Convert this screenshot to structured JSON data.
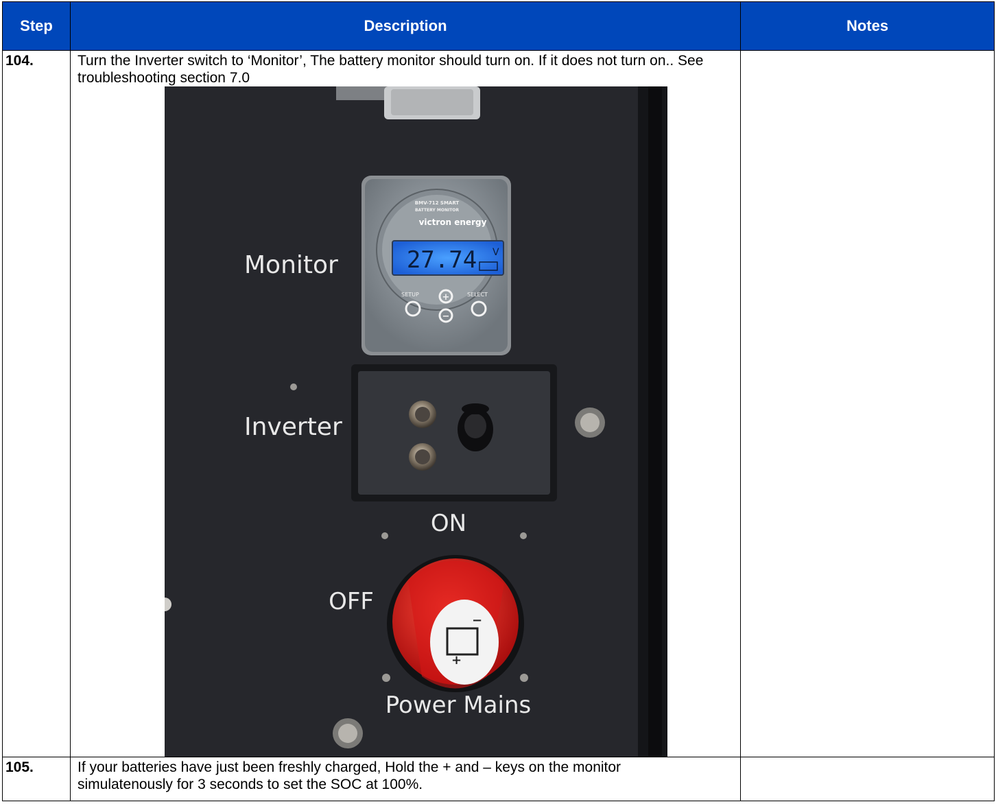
{
  "headers": {
    "step": "Step",
    "description": "Description",
    "notes": "Notes"
  },
  "rows": [
    {
      "step": "104.",
      "description": "Turn the Inverter switch to ‘Monitor’, The battery monitor should turn on. If it does not turn on.. See troubleshooting section 7.0",
      "notes": ""
    },
    {
      "step": "105.",
      "description": "If your batteries have just been freshly charged, Hold the + and – keys on the monitor simulatenously for 3 seconds to set the SOC at 100%.",
      "notes": ""
    }
  ],
  "photo": {
    "label_monitor": "Monitor",
    "label_inverter": "Inverter",
    "label_on": "ON",
    "label_off": "OFF",
    "label_power_mains": "Power Mains",
    "monitor_model": "BMV-712 SMART",
    "monitor_subtitle": "BATTERY MONITOR",
    "brand": "victron energy",
    "display_value": "27.74",
    "display_unit": "V",
    "btn_setup": "SETUP",
    "btn_select": "SELECT"
  }
}
